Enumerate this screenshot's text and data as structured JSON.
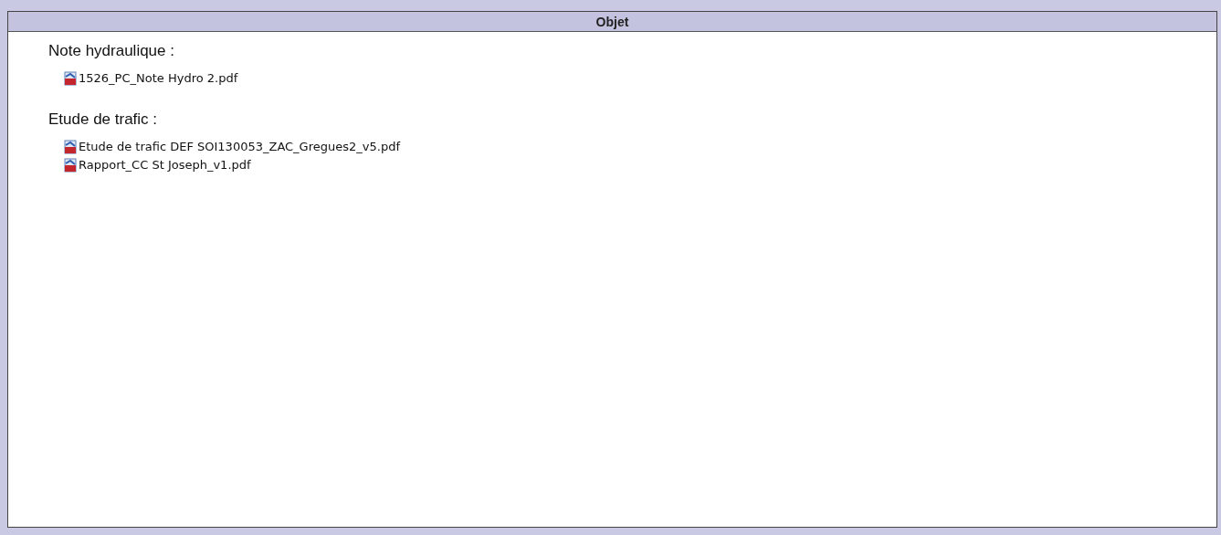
{
  "table": {
    "header": "Objet",
    "sections": [
      {
        "title": "Note hydraulique :",
        "files": [
          "1526_PC_Note Hydro 2.pdf"
        ]
      },
      {
        "title": "Etude de trafic :",
        "files": [
          "Etude de trafic DEF SOI130053_ZAC_Gregues2_v5.pdf",
          "Rapport_CC St Joseph_v1.pdf"
        ]
      }
    ]
  }
}
